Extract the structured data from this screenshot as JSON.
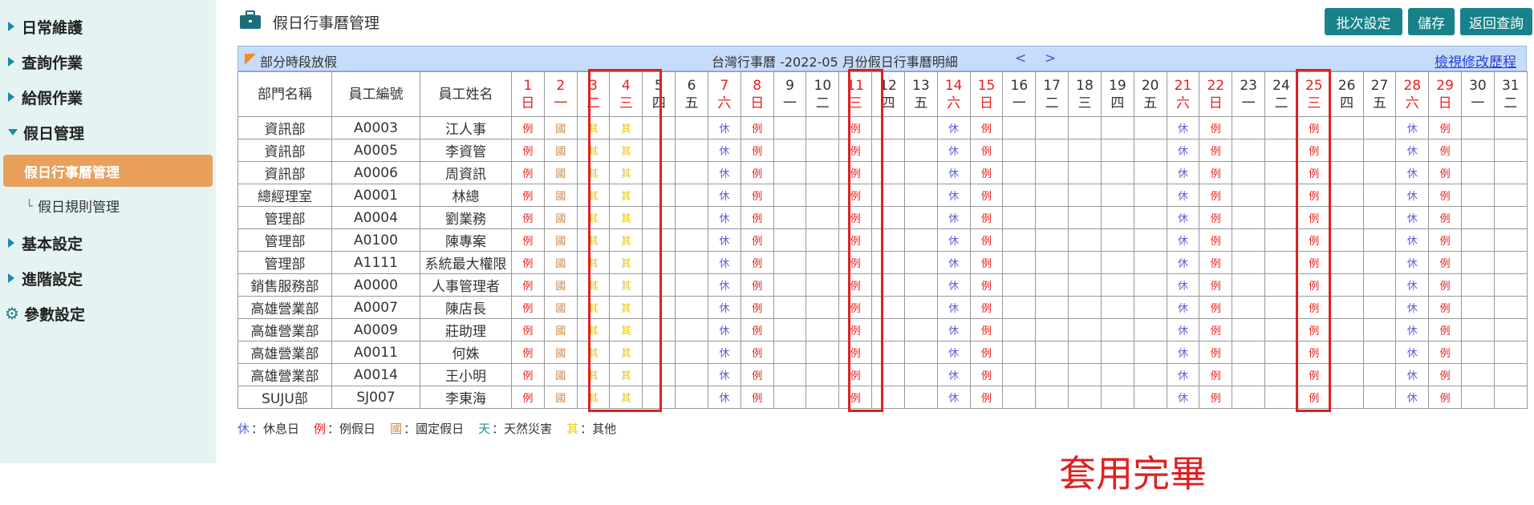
{
  "sidebar": {
    "items": [
      {
        "label": "日常維護"
      },
      {
        "label": "查詢作業"
      },
      {
        "label": "給假作業"
      },
      {
        "label": "假日管理"
      },
      {
        "label": "基本設定"
      },
      {
        "label": "進階設定"
      },
      {
        "label": "參數設定"
      }
    ],
    "active_sub": "假日行事曆管理",
    "sub": "假日規則管理"
  },
  "header": {
    "title": "假日行事曆管理",
    "buttons": {
      "batch": "批次設定",
      "save": "儲存",
      "back": "返回查詢"
    }
  },
  "calendar": {
    "partial_label": "部分時段放假",
    "title": "台灣行事曆 -2022-05 月份假日行事曆明細",
    "prev": "<",
    "next": ">",
    "history_link": "檢視修改歷程",
    "col_headers": {
      "dept": "部門名稱",
      "emp_id": "員工編號",
      "emp_name": "員工姓名"
    },
    "days": [
      {
        "d": "1",
        "w": "日",
        "red": true
      },
      {
        "d": "2",
        "w": "一",
        "red": true
      },
      {
        "d": "3",
        "w": "二",
        "red": true
      },
      {
        "d": "4",
        "w": "三",
        "red": true
      },
      {
        "d": "5",
        "w": "四",
        "red": false
      },
      {
        "d": "6",
        "w": "五",
        "red": false
      },
      {
        "d": "7",
        "w": "六",
        "red": true
      },
      {
        "d": "8",
        "w": "日",
        "red": true
      },
      {
        "d": "9",
        "w": "一",
        "red": false
      },
      {
        "d": "10",
        "w": "二",
        "red": false
      },
      {
        "d": "11",
        "w": "三",
        "red": true
      },
      {
        "d": "12",
        "w": "四",
        "red": false
      },
      {
        "d": "13",
        "w": "五",
        "red": false
      },
      {
        "d": "14",
        "w": "六",
        "red": true
      },
      {
        "d": "15",
        "w": "日",
        "red": true
      },
      {
        "d": "16",
        "w": "一",
        "red": false
      },
      {
        "d": "17",
        "w": "二",
        "red": false
      },
      {
        "d": "18",
        "w": "三",
        "red": false
      },
      {
        "d": "19",
        "w": "四",
        "red": false
      },
      {
        "d": "20",
        "w": "五",
        "red": false
      },
      {
        "d": "21",
        "w": "六",
        "red": true
      },
      {
        "d": "22",
        "w": "日",
        "red": true
      },
      {
        "d": "23",
        "w": "一",
        "red": false
      },
      {
        "d": "24",
        "w": "二",
        "red": false
      },
      {
        "d": "25",
        "w": "三",
        "red": true
      },
      {
        "d": "26",
        "w": "四",
        "red": false
      },
      {
        "d": "27",
        "w": "五",
        "red": false
      },
      {
        "d": "28",
        "w": "六",
        "red": true
      },
      {
        "d": "29",
        "w": "日",
        "red": true
      },
      {
        "d": "30",
        "w": "一",
        "red": false
      },
      {
        "d": "31",
        "w": "二",
        "red": false
      }
    ],
    "pattern": {
      "1": "li",
      "2": "guo",
      "3": "qi",
      "4": "qi",
      "7": "xiu",
      "8": "li",
      "11": "li",
      "14": "xiu",
      "15": "li",
      "21": "xiu",
      "22": "li",
      "25": "li",
      "28": "xiu",
      "29": "li"
    },
    "rows": [
      {
        "dept": "資訊部",
        "id": "A0003",
        "name": "江人事"
      },
      {
        "dept": "資訊部",
        "id": "A0005",
        "name": "李資管"
      },
      {
        "dept": "資訊部",
        "id": "A0006",
        "name": "周資訊"
      },
      {
        "dept": "總經理室",
        "id": "A0001",
        "name": "林總"
      },
      {
        "dept": "管理部",
        "id": "A0004",
        "name": "劉業務"
      },
      {
        "dept": "管理部",
        "id": "A0100",
        "name": "陳專案"
      },
      {
        "dept": "管理部",
        "id": "A1111",
        "name": "系統最大權限"
      },
      {
        "dept": "銷售服務部",
        "id": "A0000",
        "name": "人事管理者"
      },
      {
        "dept": "高雄營業部",
        "id": "A0007",
        "name": "陳店長"
      },
      {
        "dept": "高雄營業部",
        "id": "A0009",
        "name": "莊助理"
      },
      {
        "dept": "高雄營業部",
        "id": "A0011",
        "name": "何姝"
      },
      {
        "dept": "高雄營業部",
        "id": "A0014",
        "name": "王小明"
      },
      {
        "dept": "SUJU部",
        "id": "SJ007",
        "name": "李東海"
      }
    ]
  },
  "labels": {
    "li": "例",
    "guo": "國",
    "qi": "其",
    "xiu": "休",
    "tian": "天"
  },
  "legend": [
    {
      "key": "休",
      "text": "：休息日",
      "color": "#5b62d4"
    },
    {
      "key": "例",
      "text": "：例假日",
      "color": "#e8201c"
    },
    {
      "key": "國",
      "text": "：國定假日",
      "color": "#c98a4a"
    },
    {
      "key": "天",
      "text": "：天然災害",
      "color": "#1a9a8a"
    },
    {
      "key": "其",
      "text": "：其他",
      "color": "#e8c70a"
    }
  ],
  "done_note": "套用完畢"
}
